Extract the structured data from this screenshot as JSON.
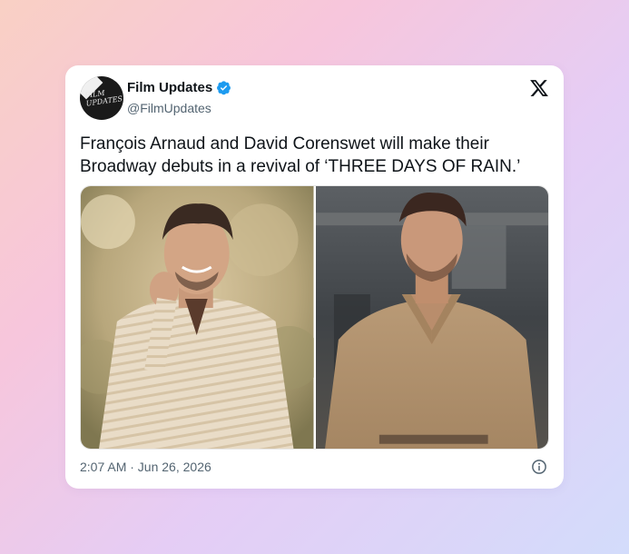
{
  "tweet": {
    "display_name": "Film Updates",
    "handle": "@FilmUpdates",
    "avatar_logo_text": "FILM UPDATES",
    "verified": true,
    "text": "François Arnaud and David Corenswet will make their Broadway debuts in a revival of ‘THREE DAYS OF RAIN.’",
    "timestamp": "2:07 AM · Jun 26, 2026",
    "media": [
      {
        "name": "photo-francois-arnaud"
      },
      {
        "name": "photo-david-corenswet"
      }
    ]
  },
  "icons": {
    "verified": "verified-badge-icon",
    "platform": "x-logo-icon",
    "info": "info-icon"
  },
  "colors": {
    "verified_blue": "#1d9bf0",
    "text": "#0f1419",
    "secondary": "#536471"
  }
}
